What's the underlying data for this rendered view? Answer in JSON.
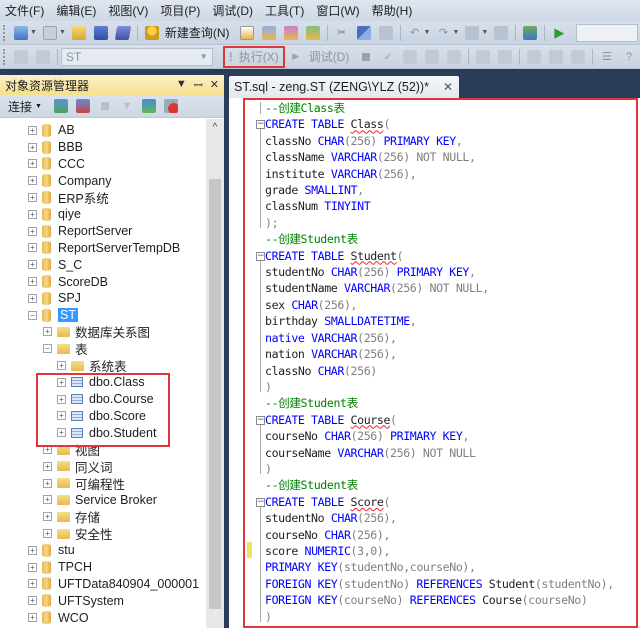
{
  "menubar": {
    "items": [
      "文件(F)",
      "编辑(E)",
      "视图(V)",
      "项目(P)",
      "调试(D)",
      "工具(T)",
      "窗口(W)",
      "帮助(H)"
    ]
  },
  "toolbar1": {
    "new_query_label": "新建查询(N)",
    "icons": [
      "new-project-icon",
      "add-item-icon",
      "open-file-icon",
      "save-icon",
      "save-all-icon",
      "new-query-icon",
      "database-engine-query-icon",
      "mdx-query-icon",
      "dmx-query-icon",
      "xmla-query-icon",
      "cut-icon",
      "copy-icon",
      "paste-icon",
      "undo-icon",
      "redo-icon",
      "navigate-backward-icon",
      "navigate-forward-icon",
      "activity-monitor-icon",
      "start-debugging-icon"
    ]
  },
  "toolbar2": {
    "database_selected": "ST",
    "execute_label": "执行(X)",
    "debug_label": "调试(D)",
    "icons": [
      "connect-icon",
      "disconnect-icon",
      "cancel-query-icon",
      "parse-icon",
      "display-plan-icon",
      "query-designer-icon",
      "specify-values-icon",
      "include-plan-icon",
      "results-to-text-icon",
      "results-to-grid-icon",
      "results-to-file-icon",
      "comment-icon",
      "uncomment-icon"
    ]
  },
  "object_explorer": {
    "title": "对象资源管理器",
    "connect_label": "连接",
    "tree": [
      {
        "label": "AB",
        "type": "db",
        "level": 0,
        "expanded": false
      },
      {
        "label": "BBB",
        "type": "db",
        "level": 0,
        "expanded": false
      },
      {
        "label": "CCC",
        "type": "db",
        "level": 0,
        "expanded": false
      },
      {
        "label": "Company",
        "type": "db",
        "level": 0,
        "expanded": false
      },
      {
        "label": "ERP系统",
        "type": "db",
        "level": 0,
        "expanded": false
      },
      {
        "label": "qiye",
        "type": "db",
        "level": 0,
        "expanded": false
      },
      {
        "label": "ReportServer",
        "type": "db",
        "level": 0,
        "expanded": false
      },
      {
        "label": "ReportServerTempDB",
        "type": "db",
        "level": 0,
        "expanded": false
      },
      {
        "label": "S_C",
        "type": "db",
        "level": 0,
        "expanded": false
      },
      {
        "label": "ScoreDB",
        "type": "db",
        "level": 0,
        "expanded": false
      },
      {
        "label": "SPJ",
        "type": "db",
        "level": 0,
        "expanded": false
      },
      {
        "label": "ST",
        "type": "db",
        "level": 0,
        "expanded": true,
        "selected": true
      },
      {
        "label": "数据库关系图",
        "type": "folder",
        "level": 1,
        "expanded": false
      },
      {
        "label": "表",
        "type": "folder",
        "level": 1,
        "expanded": true
      },
      {
        "label": "系统表",
        "type": "folder",
        "level": 2,
        "expanded": false
      },
      {
        "label": "dbo.Class",
        "type": "table",
        "level": 2,
        "expanded": false
      },
      {
        "label": "dbo.Course",
        "type": "table",
        "level": 2,
        "expanded": false
      },
      {
        "label": "dbo.Score",
        "type": "table",
        "level": 2,
        "expanded": false
      },
      {
        "label": "dbo.Student",
        "type": "table",
        "level": 2,
        "expanded": false
      },
      {
        "label": "视图",
        "type": "folder",
        "level": 1,
        "expanded": false
      },
      {
        "label": "同义词",
        "type": "folder",
        "level": 1,
        "expanded": false
      },
      {
        "label": "可编程性",
        "type": "folder",
        "level": 1,
        "expanded": false
      },
      {
        "label": "Service Broker",
        "type": "folder",
        "level": 1,
        "expanded": false
      },
      {
        "label": "存储",
        "type": "folder",
        "level": 1,
        "expanded": false
      },
      {
        "label": "安全性",
        "type": "folder",
        "level": 1,
        "expanded": false
      },
      {
        "label": "stu",
        "type": "db",
        "level": 0,
        "expanded": false
      },
      {
        "label": "TPCH",
        "type": "db",
        "level": 0,
        "expanded": false
      },
      {
        "label": "UFTData840904_000001",
        "type": "db",
        "level": 0,
        "expanded": false
      },
      {
        "label": "UFTSystem",
        "type": "db",
        "level": 0,
        "expanded": false
      },
      {
        "label": "WCO",
        "type": "db",
        "level": 0,
        "expanded": false
      }
    ]
  },
  "editor": {
    "tab_title": "ST.sql - zeng.ST (ZENG\\YLZ (52))*",
    "lines": [
      [
        {
          "t": "--创建Class表",
          "c": "cmt"
        }
      ],
      [
        {
          "t": "CREATE TABLE ",
          "c": "kw"
        },
        {
          "t": "Class",
          "c": "err"
        },
        {
          "t": "(",
          "c": "gray"
        }
      ],
      [
        {
          "t": "classNo "
        },
        {
          "t": "CHAR",
          "c": "kw"
        },
        {
          "t": "(256) ",
          "c": "gray"
        },
        {
          "t": "PRIMARY KEY",
          "c": "kw"
        },
        {
          "t": ",",
          "c": "gray"
        }
      ],
      [
        {
          "t": "className "
        },
        {
          "t": "VARCHAR",
          "c": "kw"
        },
        {
          "t": "(256) NOT NULL,",
          "c": "gray"
        }
      ],
      [
        {
          "t": "institute "
        },
        {
          "t": "VARCHAR",
          "c": "kw"
        },
        {
          "t": "(256),",
          "c": "gray"
        }
      ],
      [
        {
          "t": "grade "
        },
        {
          "t": "SMALLINT",
          "c": "kw"
        },
        {
          "t": ",",
          "c": "gray"
        }
      ],
      [
        {
          "t": "classNum "
        },
        {
          "t": "TINYINT",
          "c": "kw"
        }
      ],
      [
        {
          "t": ");",
          "c": "gray"
        }
      ],
      [
        {
          "t": "--创建Student表",
          "c": "cmt"
        }
      ],
      [
        {
          "t": "CREATE TABLE ",
          "c": "kw"
        },
        {
          "t": "Student",
          "c": "err"
        },
        {
          "t": "(",
          "c": "gray"
        }
      ],
      [
        {
          "t": "studentNo "
        },
        {
          "t": "CHAR",
          "c": "kw"
        },
        {
          "t": "(256) ",
          "c": "gray"
        },
        {
          "t": "PRIMARY KEY",
          "c": "kw"
        },
        {
          "t": ",",
          "c": "gray"
        }
      ],
      [
        {
          "t": "studentName "
        },
        {
          "t": "VARCHAR",
          "c": "kw"
        },
        {
          "t": "(256) NOT NULL,",
          "c": "gray"
        }
      ],
      [
        {
          "t": "sex "
        },
        {
          "t": "CHAR",
          "c": "kw"
        },
        {
          "t": "(256),",
          "c": "gray"
        }
      ],
      [
        {
          "t": "birthday "
        },
        {
          "t": "SMALLDATETIME",
          "c": "kw"
        },
        {
          "t": ",",
          "c": "gray"
        }
      ],
      [
        {
          "t": "native ",
          "c": "kw"
        },
        {
          "t": "VARCHAR",
          "c": "kw"
        },
        {
          "t": "(256),",
          "c": "gray"
        }
      ],
      [
        {
          "t": "nation "
        },
        {
          "t": "VARCHAR",
          "c": "kw"
        },
        {
          "t": "(256),",
          "c": "gray"
        }
      ],
      [
        {
          "t": "classNo "
        },
        {
          "t": "CHAR",
          "c": "kw"
        },
        {
          "t": "(256)",
          "c": "gray"
        }
      ],
      [
        {
          "t": ")",
          "c": "gray"
        }
      ],
      [
        {
          "t": "--创建Student表",
          "c": "cmt"
        }
      ],
      [
        {
          "t": "CREATE TABLE ",
          "c": "kw"
        },
        {
          "t": "Course",
          "c": "err"
        },
        {
          "t": "(",
          "c": "gray"
        }
      ],
      [
        {
          "t": "courseNo "
        },
        {
          "t": "CHAR",
          "c": "kw"
        },
        {
          "t": "(256) ",
          "c": "gray"
        },
        {
          "t": "PRIMARY KEY",
          "c": "kw"
        },
        {
          "t": ",",
          "c": "gray"
        }
      ],
      [
        {
          "t": "courseName "
        },
        {
          "t": "VARCHAR",
          "c": "kw"
        },
        {
          "t": "(256) NOT NULL",
          "c": "gray"
        }
      ],
      [
        {
          "t": ")",
          "c": "gray"
        }
      ],
      [
        {
          "t": "--创建Student表",
          "c": "cmt"
        }
      ],
      [
        {
          "t": "CREATE TABLE ",
          "c": "kw"
        },
        {
          "t": "Score",
          "c": "err"
        },
        {
          "t": "(",
          "c": "gray"
        }
      ],
      [
        {
          "t": "studentNo "
        },
        {
          "t": "CHAR",
          "c": "kw"
        },
        {
          "t": "(256),",
          "c": "gray"
        }
      ],
      [
        {
          "t": "courseNo "
        },
        {
          "t": "CHAR",
          "c": "kw"
        },
        {
          "t": "(256),",
          "c": "gray"
        }
      ],
      [
        {
          "t": "score "
        },
        {
          "t": "NUMERIC",
          "c": "kw"
        },
        {
          "t": "(3,0),",
          "c": "gray"
        }
      ],
      [
        {
          "t": "PRIMARY KEY",
          "c": "kw"
        },
        {
          "t": "(studentNo,courseNo),",
          "c": "gray"
        }
      ],
      [
        {
          "t": "FOREIGN KEY",
          "c": "kw"
        },
        {
          "t": "(studentNo) ",
          "c": "gray"
        },
        {
          "t": "REFERENCES ",
          "c": "kw"
        },
        {
          "t": "Student"
        },
        {
          "t": "(studentNo),",
          "c": "gray"
        }
      ],
      [
        {
          "t": "FOREIGN KEY",
          "c": "kw"
        },
        {
          "t": "(courseNo) ",
          "c": "gray"
        },
        {
          "t": "REFERENCES ",
          "c": "kw"
        },
        {
          "t": "Course"
        },
        {
          "t": "(courseNo)",
          "c": "gray"
        }
      ],
      [
        {
          "t": ")",
          "c": "gray"
        }
      ]
    ]
  },
  "colors": {
    "highlight_box": "#e0353a",
    "keyword": "#0000ff",
    "comment": "#008000",
    "selection": "#3399ff"
  }
}
